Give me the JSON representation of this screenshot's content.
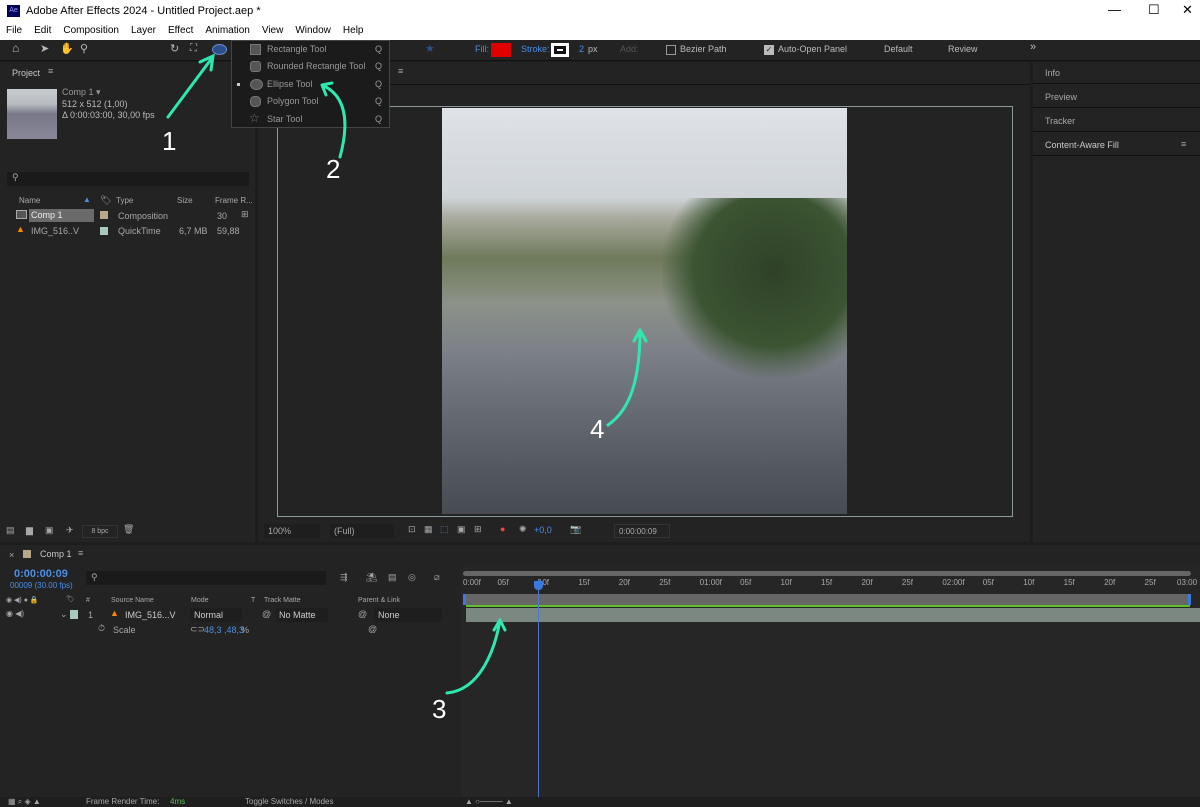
{
  "window": {
    "title": "Adobe After Effects 2024 - Untitled Project.aep *",
    "app_icon": "Ae",
    "controls": [
      "minimize",
      "maximize",
      "close"
    ]
  },
  "menu": [
    "File",
    "Edit",
    "Composition",
    "Layer",
    "Effect",
    "Animation",
    "View",
    "Window",
    "Help"
  ],
  "toolbar": {
    "fill_label": "Fill:",
    "fill_color": "#e00000",
    "stroke_label": "Stroke:",
    "stroke_width": "2",
    "stroke_unit": "px",
    "add_label": "Add:",
    "bezier_label": "Bezier Path",
    "auto_open_label": "Auto-Open Panel",
    "workspaces": [
      "Default",
      "Review"
    ],
    "more": "»"
  },
  "shape_menu": {
    "items": [
      {
        "label": "Rectangle Tool",
        "key": "Q",
        "selected": false
      },
      {
        "label": "Rounded Rectangle Tool",
        "key": "Q",
        "selected": false
      },
      {
        "label": "Ellipse Tool",
        "key": "Q",
        "selected": true
      },
      {
        "label": "Polygon Tool",
        "key": "Q",
        "selected": false
      },
      {
        "label": "Star Tool",
        "key": "Q",
        "selected": false
      }
    ]
  },
  "project": {
    "title": "Project",
    "comp_name": "Comp 1 ▾",
    "comp_size": "512 x 512 (1,00)",
    "comp_duration": "Δ 0:00:03:00, 30,00 fps",
    "columns": [
      "Name",
      "Type",
      "Size",
      "Frame R..."
    ],
    "items": [
      {
        "name": "Comp 1",
        "type": "Composition",
        "size": "",
        "frame_rate": "30",
        "label_color": "#b8a888"
      },
      {
        "name": "IMG_516..V",
        "type": "QuickTime",
        "size": "6,7 MB",
        "frame_rate": "59,88",
        "label_color": "#a8c8c0"
      }
    ],
    "bpc": "8 bpc"
  },
  "viewer": {
    "zoom": "100%",
    "resolution": "(Full)",
    "exposure": "+0,0",
    "timecode": "0:00:00:09"
  },
  "right_panels": [
    "Info",
    "Preview",
    "Tracker",
    "Content-Aware Fill"
  ],
  "timeline": {
    "tab": "Comp 1",
    "timecode": "0:00:00:09",
    "frames": "00009 (30.00 fps)",
    "columns": [
      "#",
      "Source Name",
      "Mode",
      "T",
      "Track Matte",
      "Parent & Link"
    ],
    "layer": {
      "index": "1",
      "name": "IMG_516...V",
      "mode": "Normal",
      "matte": "No Matte",
      "parent": "None"
    },
    "property": {
      "name": "Scale",
      "value": "48,3 ,48,3",
      "unit": "%"
    },
    "ruler": [
      "0:00f",
      "05f",
      "10f",
      "15f",
      "20f",
      "25f",
      "01:00f",
      "05f",
      "10f",
      "15f",
      "20f",
      "25f",
      "02:00f",
      "05f",
      "10f",
      "15f",
      "20f",
      "25f",
      "03:00"
    ],
    "playhead_frame": 9,
    "duration_frames": 90
  },
  "status": {
    "render_label": "Frame Render Time:",
    "render_value": "4ms",
    "toggle": "Toggle Switches / Modes"
  },
  "annotations": [
    "1",
    "2",
    "3",
    "4"
  ],
  "colors": {
    "accent": "#4a8ee8",
    "annotation": "#2ee8b0"
  }
}
